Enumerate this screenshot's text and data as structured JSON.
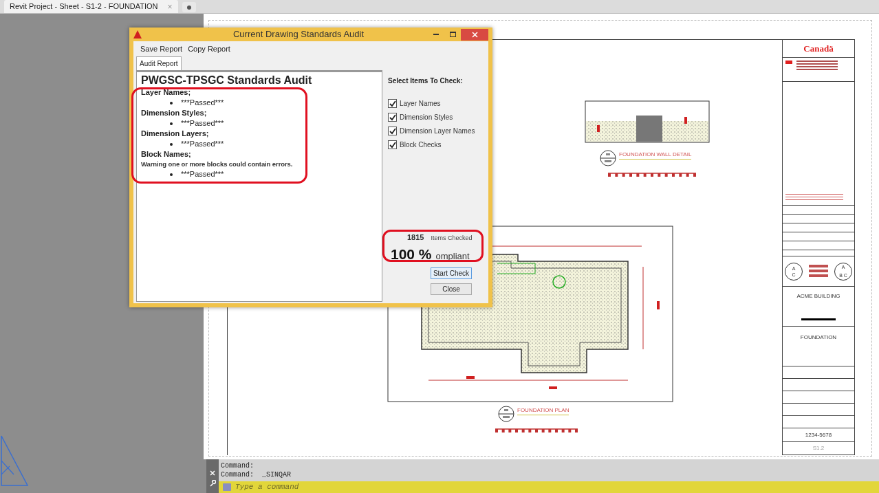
{
  "tabs": [
    {
      "label": "Revit Project - Sheet - S1-2 - FOUNDATION",
      "selected": true,
      "close": "×"
    }
  ],
  "dialog": {
    "title": "Current Drawing Standards Audit",
    "menu": [
      "Save Report",
      "Copy Report"
    ],
    "tabs": [
      {
        "label": "Audit Report",
        "selected": true
      }
    ],
    "report": {
      "heading": "PWGSC-TPSGC Standards Audit",
      "sections": [
        {
          "title": "Layer Names;",
          "items": [
            "***Passed***"
          ]
        },
        {
          "title": "Dimension Styles;",
          "items": [
            "***Passed***"
          ]
        },
        {
          "title": "Dimension Layers;",
          "items": [
            "***Passed***"
          ]
        },
        {
          "title": "Block Names;",
          "note": "Warning one or more blocks could contain errors.",
          "items": [
            "***Passed***"
          ]
        }
      ]
    },
    "checks_title": "Select Items To Check:",
    "checks": [
      {
        "label": "Layer Names",
        "checked": true
      },
      {
        "label": "Dimension Styles",
        "checked": true
      },
      {
        "label": "Dimension Layer Names",
        "checked": true
      },
      {
        "label": "Block Checks",
        "checked": true
      }
    ],
    "count": "1815",
    "count_label": "Items Checked",
    "percent": "100 %",
    "percent_label": "ompliant",
    "buttons": [
      {
        "label": "Start Check",
        "focused": true
      },
      {
        "label": "Close",
        "focused": false
      }
    ]
  },
  "sheet": {
    "wall_detail_title": "FOUNDATION WALL DETAIL",
    "plan_title": "FOUNDATION PLAN",
    "title_block": {
      "logo": "Canadä",
      "project": "ACME BUILDING",
      "sheet_title": "FOUNDATION",
      "number": "1234-5678",
      "sheet": "S1.2",
      "grid_left": [
        "A",
        "C"
      ],
      "grid_right": [
        "A",
        "B",
        "C"
      ]
    }
  },
  "command": {
    "history": [
      "Command:",
      "Command:  _SINQAR"
    ],
    "placeholder": "Type a command"
  }
}
